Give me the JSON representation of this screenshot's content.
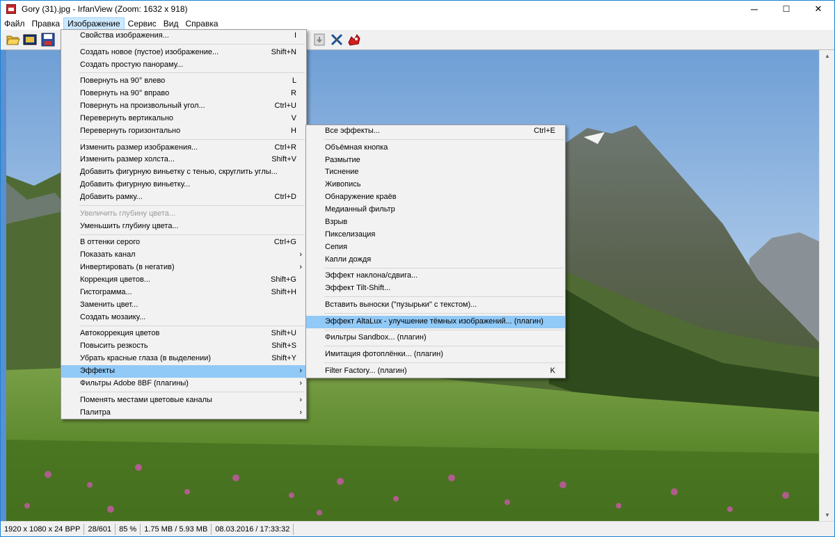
{
  "window": {
    "title": "Gory (31).jpg - IrfanView (Zoom: 1632 x 918)",
    "min": "─",
    "max": "☐",
    "close": "✕"
  },
  "menubar": [
    {
      "label": "Файл",
      "active": false
    },
    {
      "label": "Правка",
      "active": false
    },
    {
      "label": "Изображение",
      "active": true
    },
    {
      "label": "Сервис",
      "active": false
    },
    {
      "label": "Вид",
      "active": false
    },
    {
      "label": "Справка",
      "active": false
    }
  ],
  "toolbar": {
    "icons": [
      "open-icon",
      "slideshow-icon",
      "save-icon",
      "info-icon",
      "settings-icon",
      "irfanview-icon"
    ]
  },
  "image_menu": [
    {
      "label": "Свойства изображения...",
      "sc": "I"
    },
    {
      "sep": true
    },
    {
      "label": "Создать новое (пустое) изображение...",
      "sc": "Shift+N"
    },
    {
      "label": "Создать простую панораму...",
      "sc": ""
    },
    {
      "sep": true
    },
    {
      "label": "Повернуть на 90° влево",
      "sc": "L"
    },
    {
      "label": "Повернуть на 90° вправо",
      "sc": "R"
    },
    {
      "label": "Повернуть на произвольный угол...",
      "sc": "Ctrl+U"
    },
    {
      "label": "Перевернуть вертикально",
      "sc": "V"
    },
    {
      "label": "Перевернуть горизонтально",
      "sc": "H"
    },
    {
      "sep": true
    },
    {
      "label": "Изменить размер изображения...",
      "sc": "Ctrl+R"
    },
    {
      "label": "Изменить размер холста...",
      "sc": "Shift+V"
    },
    {
      "label": "Добавить фигурную виньетку с тенью, скруглить углы...",
      "sc": ""
    },
    {
      "label": "Добавить фигурную виньетку...",
      "sc": ""
    },
    {
      "label": "Добавить рамку...",
      "sc": "Ctrl+D"
    },
    {
      "sep": true
    },
    {
      "label": "Увеличить глубину цвета...",
      "sc": "",
      "disabled": true
    },
    {
      "label": "Уменьшить глубину цвета...",
      "sc": ""
    },
    {
      "sep": true
    },
    {
      "label": "В оттенки серого",
      "sc": "Ctrl+G"
    },
    {
      "label": "Показать канал",
      "sc": "",
      "sub": true
    },
    {
      "label": "Инвертировать (в негатив)",
      "sc": "",
      "sub": true
    },
    {
      "label": "Коррекция цветов...",
      "sc": "Shift+G"
    },
    {
      "label": "Гистограмма...",
      "sc": "Shift+H"
    },
    {
      "label": "Заменить цвет...",
      "sc": ""
    },
    {
      "label": "Создать мозаику...",
      "sc": ""
    },
    {
      "sep": true
    },
    {
      "label": "Автокоррекция цветов",
      "sc": "Shift+U"
    },
    {
      "label": "Повысить резкость",
      "sc": "Shift+S"
    },
    {
      "label": "Убрать красные глаза (в выделении)",
      "sc": "Shift+Y"
    },
    {
      "label": "Эффекты",
      "sc": "",
      "sub": true,
      "highlight": true
    },
    {
      "label": "Фильтры Adobe 8BF (плагины)",
      "sc": "",
      "sub": true
    },
    {
      "sep": true
    },
    {
      "label": "Поменять местами цветовые каналы",
      "sc": "",
      "sub": true
    },
    {
      "label": "Палитра",
      "sc": "",
      "sub": true
    }
  ],
  "effects_menu": [
    {
      "label": "Все эффекты...",
      "sc": "Ctrl+E"
    },
    {
      "sep": true
    },
    {
      "label": "Объёмная кнопка",
      "sc": ""
    },
    {
      "label": "Размытие",
      "sc": ""
    },
    {
      "label": "Тиснение",
      "sc": ""
    },
    {
      "label": "Живопись",
      "sc": ""
    },
    {
      "label": "Обнаружение краёв",
      "sc": ""
    },
    {
      "label": "Медианный фильтр",
      "sc": ""
    },
    {
      "label": "Взрыв",
      "sc": ""
    },
    {
      "label": "Пикселизация",
      "sc": ""
    },
    {
      "label": "Сепия",
      "sc": ""
    },
    {
      "label": "Капли дождя",
      "sc": ""
    },
    {
      "sep": true
    },
    {
      "label": "Эффект наклона/сдвига...",
      "sc": ""
    },
    {
      "label": "Эффект Tilt-Shift...",
      "sc": ""
    },
    {
      "sep": true
    },
    {
      "label": "Вставить выноски (\"пузырьки\" с текстом)...",
      "sc": ""
    },
    {
      "sep": true
    },
    {
      "label": "Эффект AltaLux - улучшение тёмных изображений... (плагин)",
      "sc": "",
      "highlight": true
    },
    {
      "sep": true
    },
    {
      "label": "Фильтры Sandbox... (плагин)",
      "sc": ""
    },
    {
      "sep": true
    },
    {
      "label": "Имитация фотоплёнки... (плагин)",
      "sc": ""
    },
    {
      "sep": true
    },
    {
      "label": "Filter Factory... (плагин)",
      "sc": "K"
    }
  ],
  "status": [
    "1920 x 1080 x 24 BPP",
    "28/601",
    "85 %",
    "1.75 MB / 5.93 MB",
    "08.03.2016 / 17:33:32"
  ]
}
